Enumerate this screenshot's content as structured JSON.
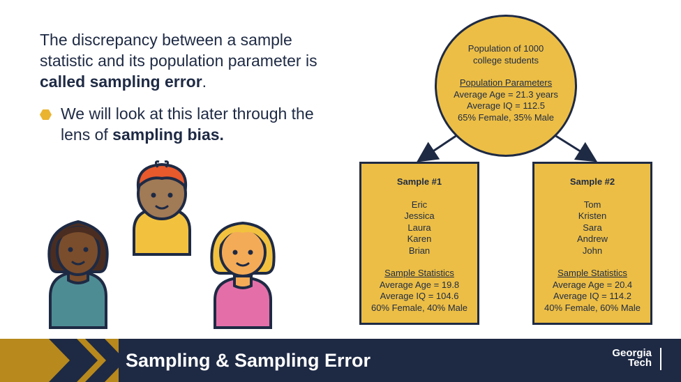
{
  "intro": {
    "text_plain": "The discrepancy between a sample statistic and its population parameter is ",
    "text_bold": "called sampling error",
    "text_end": "."
  },
  "bullet": {
    "text_plain": "We will look at this later through the lens of ",
    "text_bold": "sampling bias."
  },
  "population": {
    "line1": "Population of 1000",
    "line2": "college students",
    "params_title": "Population Parameters",
    "age": "Average Age = 21.3 years",
    "iq": "Average IQ = 112.5",
    "gender": "65% Female, 35% Male"
  },
  "samples": [
    {
      "title": "Sample #1",
      "names": [
        "Eric",
        "Jessica",
        "Laura",
        "Karen",
        "Brian"
      ],
      "stats_title": "Sample Statistics",
      "age": "Average Age = 19.8",
      "iq": "Average IQ = 104.6",
      "gender": "60% Female, 40% Male"
    },
    {
      "title": "Sample #2",
      "names": [
        "Tom",
        "Kristen",
        "Sara",
        "Andrew",
        "John"
      ],
      "stats_title": "Sample Statistics",
      "age": "Average Age = 20.4",
      "iq": "Average IQ = 114.2",
      "gender": "40% Female, 60% Male"
    }
  ],
  "footer": {
    "title": "Sampling & Sampling Error",
    "logo_line1": "Georgia",
    "logo_line2": "Tech"
  },
  "colors": {
    "navy": "#1e2a44",
    "gold": "#ecbe45",
    "footer_gold": "#b8891c"
  },
  "icons": [
    "person-brown-hair-icon",
    "person-red-hair-icon",
    "person-blonde-hair-icon",
    "chevron-right-icon"
  ]
}
